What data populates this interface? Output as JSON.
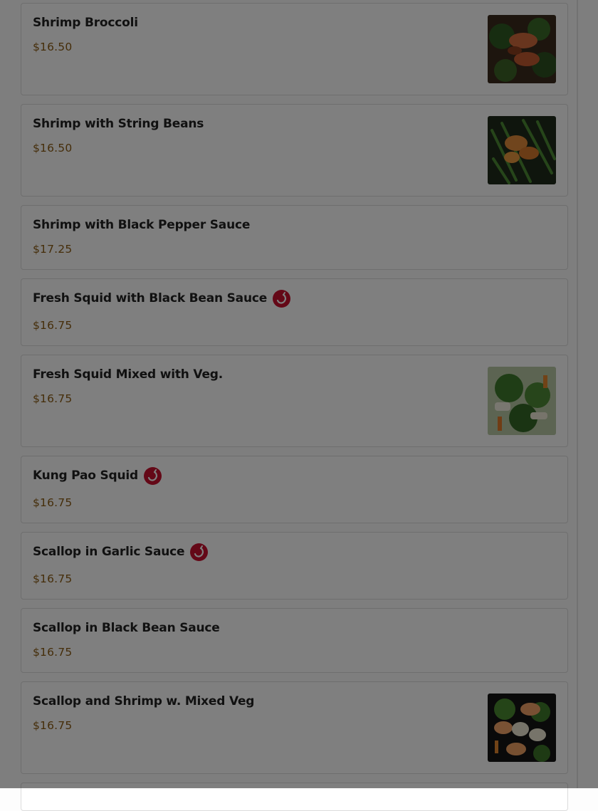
{
  "menu": {
    "items": [
      {
        "name": "Shrimp Broccoli",
        "price": "$16.50",
        "spicy": false,
        "image": "shrimp-broccoli-photo"
      },
      {
        "name": "Shrimp with String Beans",
        "price": "$16.50",
        "spicy": false,
        "image": "shrimp-string-beans-photo"
      },
      {
        "name": "Shrimp with Black Pepper Sauce",
        "price": "$17.25",
        "spicy": false
      },
      {
        "name": "Fresh Squid with Black Bean Sauce",
        "price": "$16.75",
        "spicy": true
      },
      {
        "name": "Fresh Squid Mixed with Veg.",
        "price": "$16.75",
        "spicy": false,
        "image": "squid-mixed-veg-photo"
      },
      {
        "name": "Kung Pao Squid",
        "price": "$16.75",
        "spicy": true
      },
      {
        "name": "Scallop in Garlic Sauce",
        "price": "$16.75",
        "spicy": true
      },
      {
        "name": "Scallop in Black Bean Sauce",
        "price": "$16.75",
        "spicy": false
      },
      {
        "name": "Scallop and Shrimp w. Mixed Veg",
        "price": "$16.75",
        "spicy": false,
        "image": "scallop-shrimp-veg-photo"
      }
    ]
  },
  "colors": {
    "price": "#8a5a12",
    "spicy_badge": "#c8102e",
    "modal_overlay": "rgba(0,0,0,0.5)"
  }
}
